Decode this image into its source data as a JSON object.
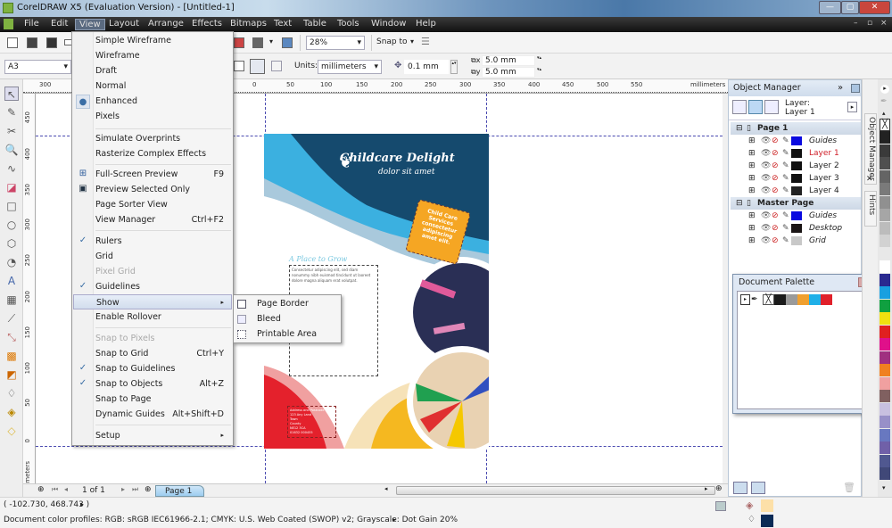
{
  "window": {
    "title": "CorelDRAW X5 (Evaluation Version) - [Untitled-1]"
  },
  "menubar": {
    "items": [
      "File",
      "Edit",
      "View",
      "Layout",
      "Arrange",
      "Effects",
      "Bitmaps",
      "Text",
      "Table",
      "Tools",
      "Window",
      "Help"
    ],
    "active": "View"
  },
  "toolbar": {
    "zoom_level": "28%",
    "snap_to_label": "Snap to",
    "page_size": "A3",
    "units_label": "Units:",
    "units_value": "millimeters",
    "nudge": "0.1 mm",
    "dup_x": "5.0 mm",
    "dup_y": "5.0 mm"
  },
  "rulers": {
    "h_ticks": [
      "300",
      "0",
      "50",
      "100",
      "150",
      "200",
      "250",
      "300",
      "350",
      "400",
      "450",
      "500",
      "550"
    ],
    "h_unit": "millimeters",
    "v_ticks": [
      "450",
      "400",
      "350",
      "300",
      "250",
      "200",
      "150",
      "100",
      "50",
      "0"
    ],
    "v_unit": "millimeters"
  },
  "view_menu": {
    "items": [
      {
        "label": "Simple Wireframe",
        "shortcut": "",
        "state": ""
      },
      {
        "label": "Wireframe",
        "shortcut": "",
        "state": ""
      },
      {
        "label": "Draft",
        "shortcut": "",
        "state": ""
      },
      {
        "label": "Normal",
        "shortcut": "",
        "state": ""
      },
      {
        "label": "Enhanced",
        "shortcut": "",
        "state": "radio"
      },
      {
        "label": "Pixels",
        "shortcut": "",
        "state": ""
      },
      {
        "label": "Simulate Overprints",
        "shortcut": "",
        "state": ""
      },
      {
        "label": "Rasterize Complex Effects",
        "shortcut": "",
        "state": ""
      },
      {
        "label": "Full-Screen Preview",
        "shortcut": "F9",
        "state": "icon"
      },
      {
        "label": "Preview Selected Only",
        "shortcut": "",
        "state": "icon"
      },
      {
        "label": "Page Sorter View",
        "shortcut": "",
        "state": ""
      },
      {
        "label": "View Manager",
        "shortcut": "Ctrl+F2",
        "state": ""
      },
      {
        "label": "Rulers",
        "shortcut": "",
        "state": "checked"
      },
      {
        "label": "Grid",
        "shortcut": "",
        "state": ""
      },
      {
        "label": "Pixel Grid",
        "shortcut": "",
        "state": "disabled"
      },
      {
        "label": "Guidelines",
        "shortcut": "",
        "state": "checked"
      },
      {
        "label": "Show",
        "shortcut": "▸",
        "state": "highlighted"
      },
      {
        "label": "Enable Rollover",
        "shortcut": "",
        "state": ""
      },
      {
        "label": "Snap to Pixels",
        "shortcut": "",
        "state": "disabled"
      },
      {
        "label": "Snap to Grid",
        "shortcut": "Ctrl+Y",
        "state": ""
      },
      {
        "label": "Snap to Guidelines",
        "shortcut": "",
        "state": "checked"
      },
      {
        "label": "Snap to Objects",
        "shortcut": "Alt+Z",
        "state": "checked"
      },
      {
        "label": "Snap to Page",
        "shortcut": "",
        "state": ""
      },
      {
        "label": "Dynamic Guides",
        "shortcut": "Alt+Shift+D",
        "state": ""
      },
      {
        "label": "Setup",
        "shortcut": "▸",
        "state": ""
      }
    ]
  },
  "show_submenu": {
    "items": [
      "Page Border",
      "Bleed",
      "Printable Area"
    ]
  },
  "flyer": {
    "brand": "Childcare Delight",
    "tagline": "dolor sit amet",
    "badge_text": "Child Care Services consectetur adipiscing amet elit.",
    "section_heading": "A Place to Grow",
    "body_text": "Consectetur adipiscing elit, sed diam nonummy nibh euismod tincidunt ut laoreet dolore magna aliquam erat volutpat.",
    "address": [
      "Address and Postcode",
      "123 Any Land",
      "Town",
      "County",
      "NE12 3CA",
      "01632 000455"
    ]
  },
  "object_manager": {
    "title": "Object Manager",
    "current_layer_label": "Layer:",
    "current_layer": "Layer 1",
    "tree": [
      {
        "type": "page",
        "label": "Page 1"
      },
      {
        "type": "layer",
        "label": "Guides",
        "color": "#0a0ae0",
        "italic": true
      },
      {
        "type": "layer",
        "label": "Layer 1",
        "color": "#111111",
        "active": true
      },
      {
        "type": "layer",
        "label": "Layer 2",
        "color": "#111111"
      },
      {
        "type": "layer",
        "label": "Layer 3",
        "color": "#111111"
      },
      {
        "type": "layer",
        "label": "Layer 4",
        "color": "#222222"
      },
      {
        "type": "page",
        "label": "Master Page"
      },
      {
        "type": "layer",
        "label": "Guides",
        "color": "#0a0ae0",
        "italic": true
      },
      {
        "type": "layer",
        "label": "Desktop",
        "color": "#1a1414",
        "italic": true
      },
      {
        "type": "layer",
        "label": "Grid",
        "color": "#c8c8c8",
        "italic": true
      }
    ]
  },
  "document_palette": {
    "title": "Document Palette",
    "colors": [
      "#1b1b1b",
      "#9a9a9a",
      "#f0a030",
      "#20b0e8",
      "#e0202a"
    ]
  },
  "dock_tabs": [
    "Object Manager",
    "Hints"
  ],
  "color_palette": [
    "#222222",
    "#3a3a3a",
    "#4f4f4f",
    "#646464",
    "#7a7a7a",
    "#909090",
    "#a6a6a6",
    "#bcbcbc",
    "#d2d2d2",
    "#e8e8e8",
    "#ffffff",
    "#2a2a90",
    "#18a0e0",
    "#10a040",
    "#f0e010",
    "#e02020",
    "#e0108a",
    "#a03080",
    "#f08020",
    "#f0a0a0",
    "#806060",
    "#c8c0e0",
    "#9890c8",
    "#6878c0",
    "#7060a8",
    "#505890",
    "#404878"
  ],
  "page_nav": {
    "position": "1 of 1",
    "tab": "Page 1"
  },
  "status": {
    "coords": "( -102.730, 468.743 )",
    "profiles": "Document color profiles: RGB: sRGB IEC61966-2.1; CMYK: U.S. Web Coated (SWOP) v2; Grayscale: Dot Gain 20%",
    "fill_color": "#fde0a8",
    "outline_color": "#0a2a55"
  }
}
